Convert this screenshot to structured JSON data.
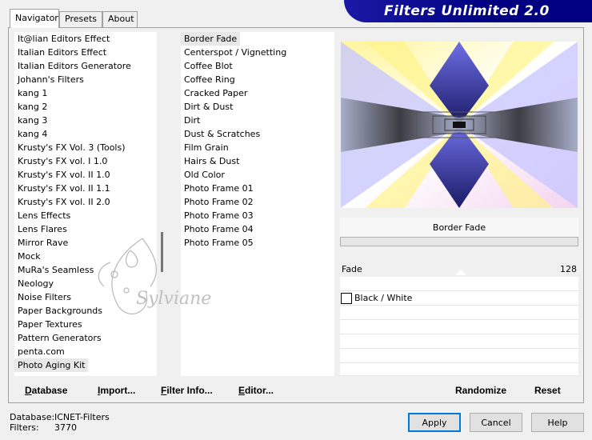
{
  "tabs": [
    "Navigator",
    "Presets",
    "About"
  ],
  "banner": "Filters Unlimited 2.0",
  "categories": [
    "It@lian Editors Effect",
    "Italian Editors Effect",
    "Italian Editors Generatore",
    "Johann's Filters",
    "kang 1",
    "kang 2",
    "kang 3",
    "kang 4",
    "Krusty's FX Vol. 3 (Tools)",
    "Krusty's FX vol. I 1.0",
    "Krusty's FX vol. II 1.0",
    "Krusty's FX vol. II 1.1",
    "Krusty's FX vol. II 2.0",
    "Lens Effects",
    "Lens Flares",
    "Mirror Rave",
    "Mock",
    "MuRa's Seamless",
    "Neology",
    "Noise Filters",
    "Paper Backgrounds",
    "Paper Textures",
    "Pattern Generators",
    "penta.com",
    "Photo Aging Kit"
  ],
  "selected_category": "Photo Aging Kit",
  "filters": [
    "Border Fade",
    "Centerspot / Vignetting",
    "Coffee Blot",
    "Coffee Ring",
    "Cracked Paper",
    "Dirt & Dust",
    "Dirt",
    "Dust & Scratches",
    "Film Grain",
    "Hairs & Dust",
    "Old Color",
    "Photo Frame 01",
    "Photo Frame 02",
    "Photo Frame 03",
    "Photo Frame 04",
    "Photo Frame 05"
  ],
  "selected_filter": "Border Fade",
  "watermark": "Sylviane",
  "filter_title": "Border Fade",
  "param": {
    "label": "Fade",
    "value": "128"
  },
  "checkbox": {
    "label": "Black / White",
    "checked": false
  },
  "buttons": {
    "database": "Database",
    "import": "Import...",
    "filter_info": "Filter Info...",
    "editor": "Editor...",
    "randomize": "Randomize",
    "reset": "Reset",
    "apply": "Apply",
    "cancel": "Cancel",
    "help": "Help"
  },
  "info": {
    "database_label": "Database:",
    "database_value": "ICNET-Filters",
    "filters_label": "Filters:",
    "filters_value": "3770"
  },
  "colors": {
    "banner": "#000080",
    "default_button_border": "#0078d7"
  }
}
